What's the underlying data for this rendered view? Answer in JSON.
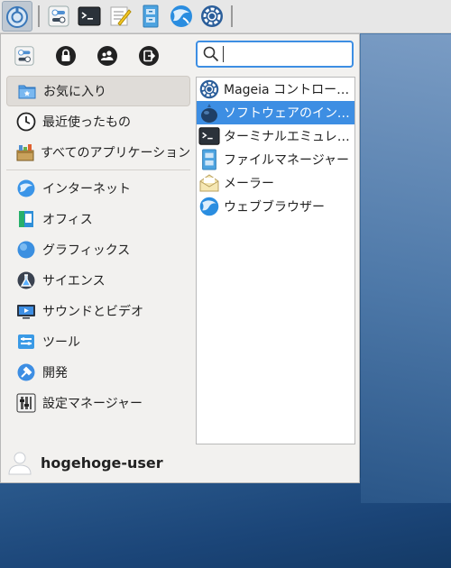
{
  "desktop": {
    "panel": {
      "menu_button_icon": "whisker-menu-icon",
      "launchers": [
        {
          "icon": "settings-manager-icon",
          "name": "settings"
        },
        {
          "icon": "terminal-icon",
          "name": "terminal"
        },
        {
          "icon": "text-editor-icon",
          "name": "text-editor"
        },
        {
          "icon": "file-manager-icon",
          "name": "file-manager"
        },
        {
          "icon": "web-browser-icon",
          "name": "web-browser"
        },
        {
          "icon": "mageia-control-center-icon",
          "name": "control-center"
        }
      ]
    }
  },
  "menu": {
    "actions": [
      "settings-manager-icon",
      "lock-screen-icon",
      "switch-user-icon",
      "log-out-icon"
    ],
    "search": {
      "value": "",
      "placeholder": ""
    },
    "categories": [
      {
        "label": "お気に入り",
        "icon": "favorites-icon",
        "selected": true
      },
      {
        "label": "最近使ったもの",
        "icon": "clock-icon"
      },
      {
        "label": "すべてのアプリケーション",
        "icon": "all-apps-icon"
      }
    ],
    "categories2": [
      {
        "label": "インターネット",
        "icon": "internet-icon"
      },
      {
        "label": "オフィス",
        "icon": "office-icon"
      },
      {
        "label": "グラフィックス",
        "icon": "graphics-icon"
      },
      {
        "label": "サイエンス",
        "icon": "science-icon"
      },
      {
        "label": "サウンドとビデオ",
        "icon": "multimedia-icon"
      },
      {
        "label": "ツール",
        "icon": "tools-icon"
      },
      {
        "label": "開発",
        "icon": "development-icon"
      },
      {
        "label": "設定マネージャー",
        "icon": "settings-manager-icon"
      }
    ],
    "apps": [
      {
        "label": "Mageia コントロール …",
        "icon": "mageia-control-center-icon"
      },
      {
        "label": "ソフトウェアのインス…",
        "icon": "software-install-icon",
        "selected": true
      },
      {
        "label": "ターミナルエミュレー…",
        "icon": "terminal-icon"
      },
      {
        "label": "ファイルマネージャー",
        "icon": "file-manager-icon"
      },
      {
        "label": "メーラー",
        "icon": "mail-icon"
      },
      {
        "label": "ウェブブラウザー",
        "icon": "web-browser-icon"
      }
    ],
    "user": {
      "name": "hogehoge-user"
    }
  },
  "colors": {
    "accent": "#3d8ee3",
    "menu_bg": "#f2f1ef"
  }
}
